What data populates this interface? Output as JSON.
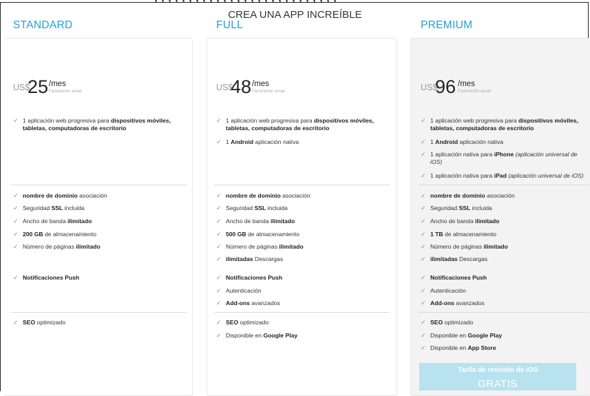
{
  "page": {
    "title": "CREA UNA APP INCREÍBLE",
    "top_cut_text": ", , , , , , , , , , , , , , , , , , , , , , , , , , ,"
  },
  "colors": {
    "accent": "#1fa0d8",
    "premium_bg": "#f3f3f3",
    "ios_box_bg": "#b8e2ef"
  },
  "plans": [
    {
      "name": "STANDARD",
      "currency": "US$",
      "amount": "25",
      "period": "/mes",
      "billing": "Facturación anual",
      "group1": [
        {
          "pre": "1 aplicación web progresiva para ",
          "bold": "dispositivos móviles,",
          "line2": "tabletas, computadoras de escritorio"
        }
      ],
      "group2": [
        {
          "bold": "nombre de dominio",
          "post": " asociación"
        },
        {
          "pre": "Seguridad ",
          "bold": "SSL",
          "post": " incluida"
        },
        {
          "pre": "Ancho de banda ",
          "bold": "ilimitado"
        },
        {
          "bold": "200 GB",
          "post": " de almacenamiento"
        },
        {
          "pre": "Número de páginas ",
          "bold": "ilimitado"
        }
      ],
      "group3": [
        {
          "bold": "Notificaciones Push"
        }
      ],
      "group4": [
        {
          "bold": "SEO",
          "post": " optimizado"
        }
      ]
    },
    {
      "name": "FULL",
      "currency": "US$",
      "amount": "48",
      "period": "/mes",
      "billing": "Facturación anual",
      "group1": [
        {
          "pre": "1 aplicación web progresiva para ",
          "bold": "dispositivos móviles,",
          "line2": "tabletas, computadoras de escritorio"
        },
        {
          "pre": "1 ",
          "bold": "Android",
          "post": " aplicación nativa"
        }
      ],
      "group2": [
        {
          "bold": "nombre de dominio",
          "post": " asociación"
        },
        {
          "pre": "Seguridad ",
          "bold": "SSL",
          "post": " incluida"
        },
        {
          "pre": "Ancho de banda ",
          "bold": "ilimitado"
        },
        {
          "bold": "500 GB",
          "post": " de almacenamiento"
        },
        {
          "pre": "Número de páginas ",
          "bold": "ilimitado"
        },
        {
          "bold": "ilimitadas",
          "post": " Descargas"
        }
      ],
      "group3": [
        {
          "bold": "Notificaciones Push"
        },
        {
          "pre": "Autenticación"
        },
        {
          "bold": "Add-ons",
          "post": " avanzados"
        }
      ],
      "group4": [
        {
          "bold": "SEO",
          "post": " optimizado"
        },
        {
          "pre": "Disponible en ",
          "bold": "Google Play"
        }
      ]
    },
    {
      "name": "PREMIUM",
      "currency": "US$",
      "amount": "96",
      "period": "/mes",
      "billing": "Facturación anual",
      "group1": [
        {
          "pre": "1 aplicación web progresiva para ",
          "bold": "dispositivos móviles,",
          "line2": "tabletas, computadoras de escritorio"
        },
        {
          "pre": "1 ",
          "bold": "Android",
          "post": " aplicación nativa"
        },
        {
          "pre": "1 aplicación nativa para ",
          "bold": "iPhone",
          "italic": " (aplicación universal de",
          "line2i": "iOS)"
        },
        {
          "pre": "1 aplicación nativa para ",
          "bold": "iPad",
          "italic": " (aplicación universal de iOS)"
        }
      ],
      "group2": [
        {
          "bold": "nombre de dominio",
          "post": " asociación"
        },
        {
          "pre": "Seguridad ",
          "bold": "SSL",
          "post": " incluida"
        },
        {
          "pre": "Ancho de banda ",
          "bold": "ilimitado"
        },
        {
          "bold": "1 TB",
          "post": " de almacenamiento"
        },
        {
          "pre": "Número de páginas ",
          "bold": "ilimitado"
        },
        {
          "bold": "ilimitadas",
          "post": " Descargas"
        }
      ],
      "group3": [
        {
          "bold": "Notificaciones Push"
        },
        {
          "pre": "Autenticación"
        },
        {
          "bold": "Add-ons",
          "post": " avanzados"
        }
      ],
      "group4": [
        {
          "bold": "SEO",
          "post": " optimizado"
        },
        {
          "pre": "Disponible en ",
          "bold": "Google Play"
        },
        {
          "pre": "Disponible en ",
          "bold": "App Store"
        }
      ]
    }
  ],
  "ios_review": {
    "label": "Tarifa de revisión de iOS",
    "price": "GRATIS"
  }
}
